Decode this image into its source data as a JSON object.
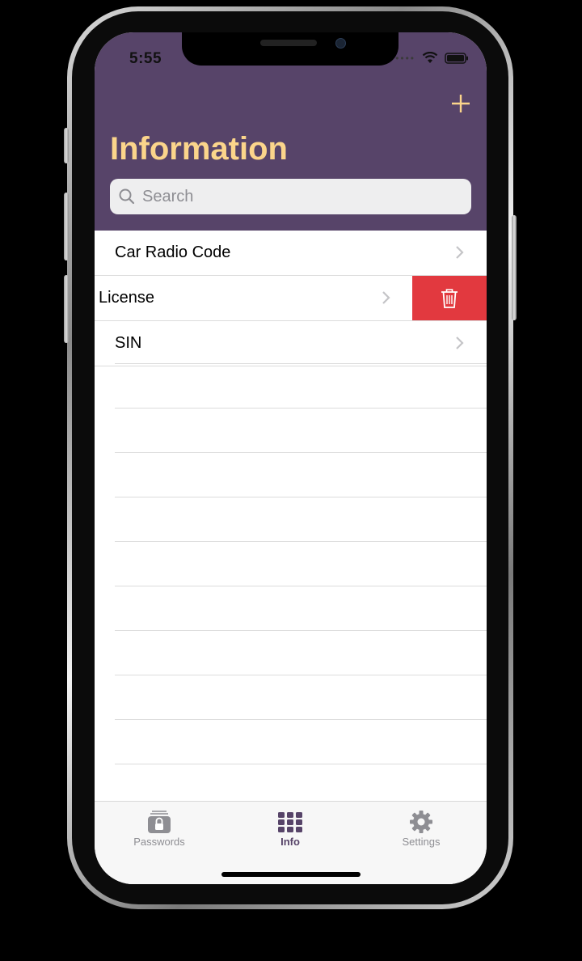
{
  "status": {
    "time": "5:55"
  },
  "header": {
    "title": "Information",
    "add_icon": "plus-icon"
  },
  "search": {
    "placeholder": "Search",
    "value": ""
  },
  "list": {
    "items": [
      {
        "label": "Car Radio Code"
      },
      {
        "label": "License",
        "swiped": true,
        "action_icon": "trash-icon"
      },
      {
        "label": "SIN"
      }
    ]
  },
  "tabs": [
    {
      "label": "Passwords",
      "icon": "lock-box-icon",
      "active": false
    },
    {
      "label": "Info",
      "icon": "grid-icon",
      "active": true
    },
    {
      "label": "Settings",
      "icon": "gear-icon",
      "active": false
    }
  ],
  "colors": {
    "header_bg": "#574469",
    "title": "#fbd58b",
    "delete": "#e2393f",
    "active_tab": "#574469"
  }
}
